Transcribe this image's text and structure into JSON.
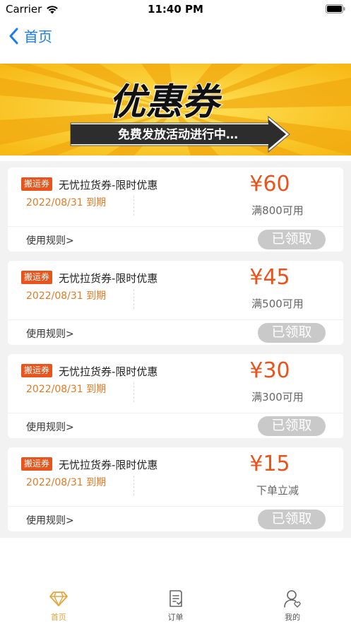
{
  "status_bar": {
    "carrier": "Carrier",
    "time": "11:40 PM"
  },
  "nav": {
    "back_label": "首页"
  },
  "banner": {
    "title": "优惠券",
    "subtitle": "免费发放活动进行中…"
  },
  "coupons": [
    {
      "tag": "搬运券",
      "title": "无忧拉货券-限时优惠",
      "expiry": "2022/08/31 到期",
      "amount": "¥60",
      "condition": "满800可用",
      "rules": "使用规则>",
      "button": "已领取"
    },
    {
      "tag": "搬运券",
      "title": "无忧拉货券-限时优惠",
      "expiry": "2022/08/31 到期",
      "amount": "¥45",
      "condition": "满500可用",
      "rules": "使用规则>",
      "button": "已领取"
    },
    {
      "tag": "搬运券",
      "title": "无忧拉货券-限时优惠",
      "expiry": "2022/08/31 到期",
      "amount": "¥30",
      "condition": "满300可用",
      "rules": "使用规则>",
      "button": "已领取"
    },
    {
      "tag": "搬运券",
      "title": "无忧拉货券-限时优惠",
      "expiry": "2022/08/31 到期",
      "amount": "¥15",
      "condition": "下单立减",
      "rules": "使用规则>",
      "button": "已领取"
    }
  ],
  "tab_bar": {
    "items": [
      {
        "label": "首页",
        "icon": "diamond-icon",
        "active": true
      },
      {
        "label": "订单",
        "icon": "order-icon",
        "active": false
      },
      {
        "label": "我的",
        "icon": "profile-icon",
        "active": false
      }
    ]
  },
  "colors": {
    "accent": "#e8541b",
    "expiry": "#e07a24",
    "nav": "#1a7cf2",
    "tab_active": "#e8a33a",
    "banner_yellow": "#f7c416"
  }
}
